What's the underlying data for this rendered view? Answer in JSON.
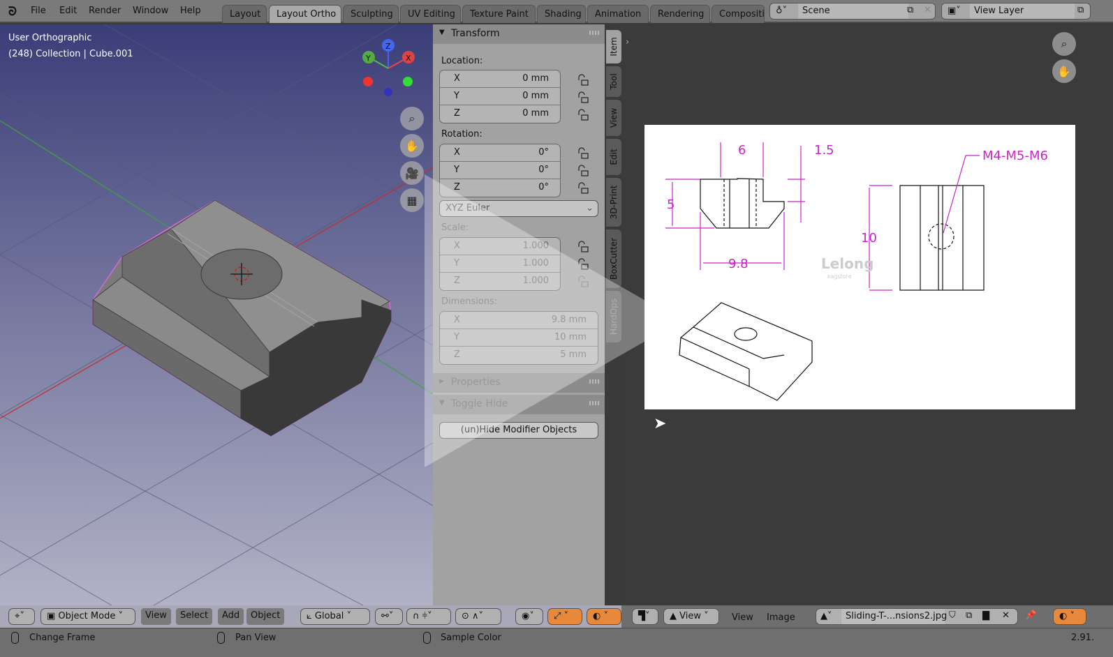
{
  "menu": [
    "File",
    "Edit",
    "Render",
    "Window",
    "Help"
  ],
  "workspaces": [
    {
      "label": "Layout",
      "active": false
    },
    {
      "label": "Layout Ortho",
      "active": true
    },
    {
      "label": "Sculpting",
      "active": false
    },
    {
      "label": "UV Editing",
      "active": false
    },
    {
      "label": "Texture Paint",
      "active": false
    },
    {
      "label": "Shading",
      "active": false
    },
    {
      "label": "Animation",
      "active": false
    },
    {
      "label": "Rendering",
      "active": false
    },
    {
      "label": "Compositi",
      "active": false
    }
  ],
  "scene": {
    "label": "Scene",
    "icon": "scene-icon"
  },
  "view_layer": {
    "label": "View Layer",
    "icon": "view-layer-icon"
  },
  "viewport": {
    "view_name": "User Orthographic",
    "collection": "(248) Collection | Cube.001",
    "gizmo": {
      "x": "X",
      "y": "Y",
      "z": "Z"
    },
    "selection_color": "#d966d9"
  },
  "npanel": {
    "transform_title": "Transform",
    "location_label": "Location:",
    "location": [
      {
        "axis": "X",
        "value": "0 mm"
      },
      {
        "axis": "Y",
        "value": "0 mm"
      },
      {
        "axis": "Z",
        "value": "0 mm"
      }
    ],
    "rotation_label": "Rotation:",
    "rotation": [
      {
        "axis": "X",
        "value": "0°"
      },
      {
        "axis": "Y",
        "value": "0°"
      },
      {
        "axis": "Z",
        "value": "0°"
      }
    ],
    "rotation_mode": "XYZ Euler",
    "scale_label": "Scale:",
    "scale": [
      {
        "axis": "X",
        "value": "1.000"
      },
      {
        "axis": "Y",
        "value": "1.000"
      },
      {
        "axis": "Z",
        "value": "1.000"
      }
    ],
    "dimensions_label": "Dimensions:",
    "dimensions": [
      {
        "axis": "X",
        "value": "9.8 mm"
      },
      {
        "axis": "Y",
        "value": "10 mm"
      },
      {
        "axis": "Z",
        "value": "5 mm"
      }
    ],
    "properties_title": "Properties",
    "toggle_hide_title": "Toggle Hide",
    "unhide_button": "(un)Hide Modifier Objects"
  },
  "side_tabs": [
    {
      "label": "Item",
      "active": true
    },
    {
      "label": "Tool",
      "active": false
    },
    {
      "label": "View",
      "active": false
    },
    {
      "label": "Edit",
      "active": false
    },
    {
      "label": "3D-Print",
      "active": false
    },
    {
      "label": "BoxCutter",
      "active": false
    },
    {
      "label": "HardOps",
      "active": false
    }
  ],
  "image": {
    "dim_top": "6",
    "dim_step": "1.5",
    "dim_height": "5",
    "dim_width": "9.8",
    "dim_length": "10",
    "thread": "M4-M5-M6",
    "watermark": "Lelong",
    "watermark_sub": "kagstore",
    "annotation_color": "#cc22cc"
  },
  "viewport_header": {
    "mode": "Object Mode",
    "menus": [
      "View",
      "Select",
      "Add",
      "Object"
    ],
    "orientation": "Global"
  },
  "image_header": {
    "view_dropdown": "View",
    "menus": [
      "View",
      "Image"
    ],
    "image_name": "Sliding-T-...nsions2.jpg"
  },
  "status": {
    "left": "Change Frame",
    "middle": "Pan View",
    "right": "Sample Color",
    "version": "2.91."
  }
}
